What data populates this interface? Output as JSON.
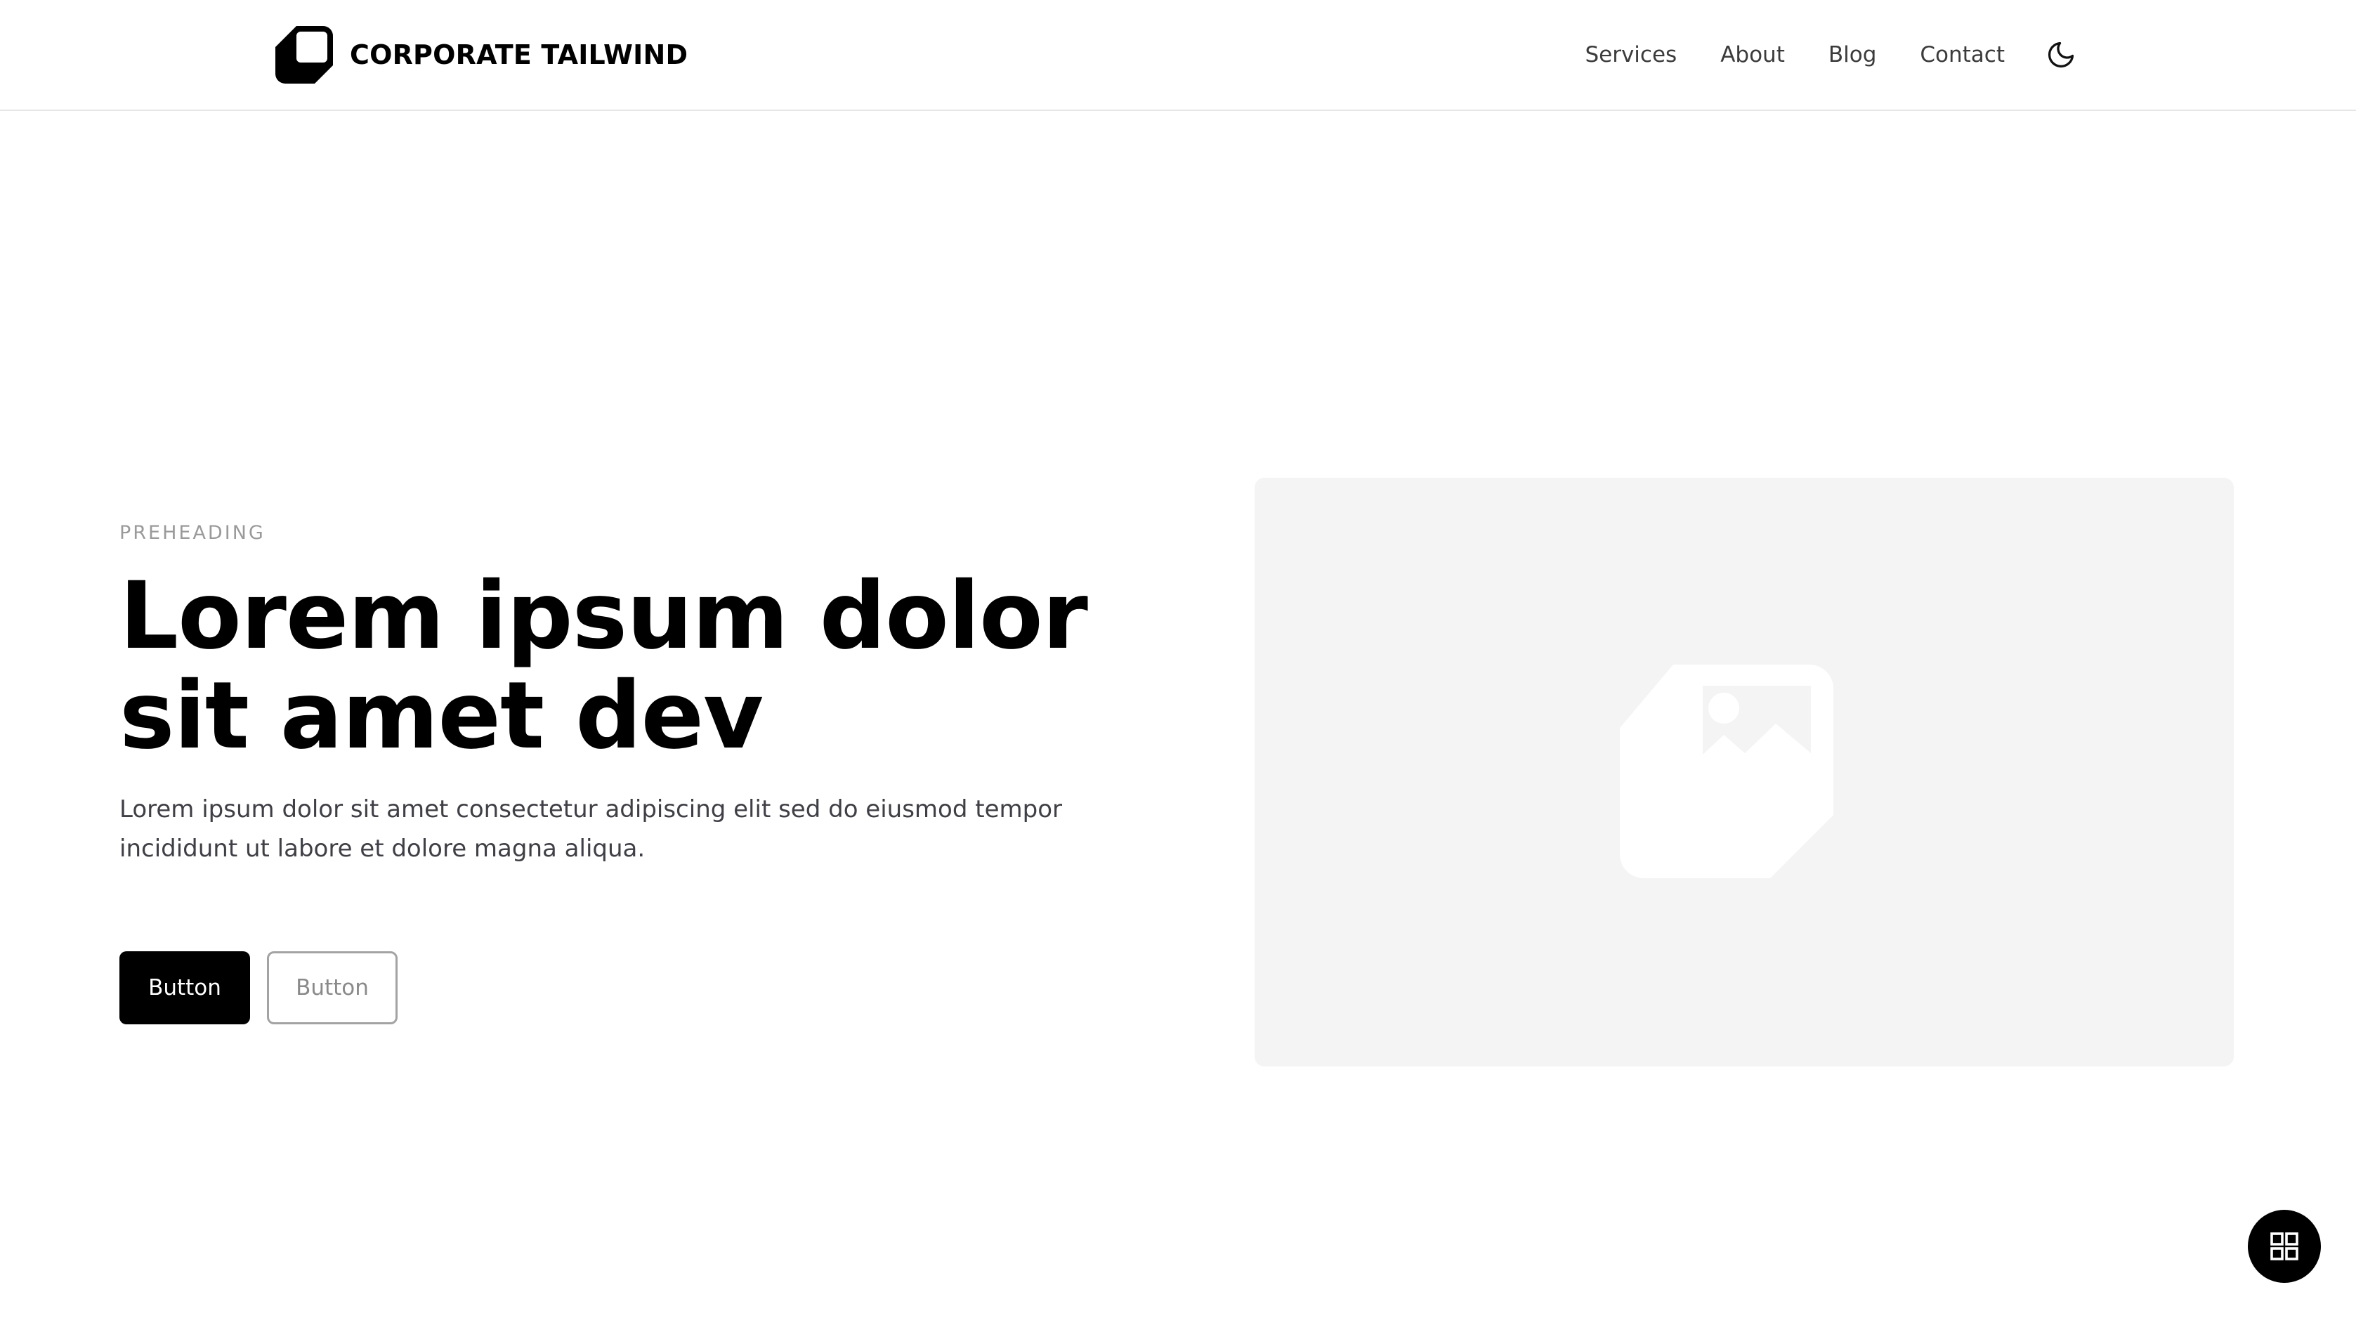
{
  "header": {
    "brand_name": "CORPORATE TAILWIND",
    "logo_icon": "logo-icon",
    "nav": [
      {
        "label": "Services"
      },
      {
        "label": "About"
      },
      {
        "label": "Blog"
      },
      {
        "label": "Contact"
      }
    ],
    "theme_toggle_icon": "moon-icon"
  },
  "hero": {
    "preheading": "PREHEADING",
    "headline": "Lorem ipsum dolor sit amet dev",
    "description": "Lorem ipsum dolor sit amet consectetur adipiscing elit sed do eiusmod tempor incididunt ut labore et dolore magna aliqua.",
    "primary_button": "Button",
    "secondary_button": "Button"
  },
  "image_placeholder": {
    "icon": "image-icon"
  },
  "fab": {
    "icon": "grid-icon"
  },
  "colors": {
    "primary": "#000000",
    "text_muted": "#9a9a9a",
    "body_text": "#3f3f46",
    "placeholder_bg": "#f4f4f4",
    "placeholder_icon": "#ffffff"
  }
}
